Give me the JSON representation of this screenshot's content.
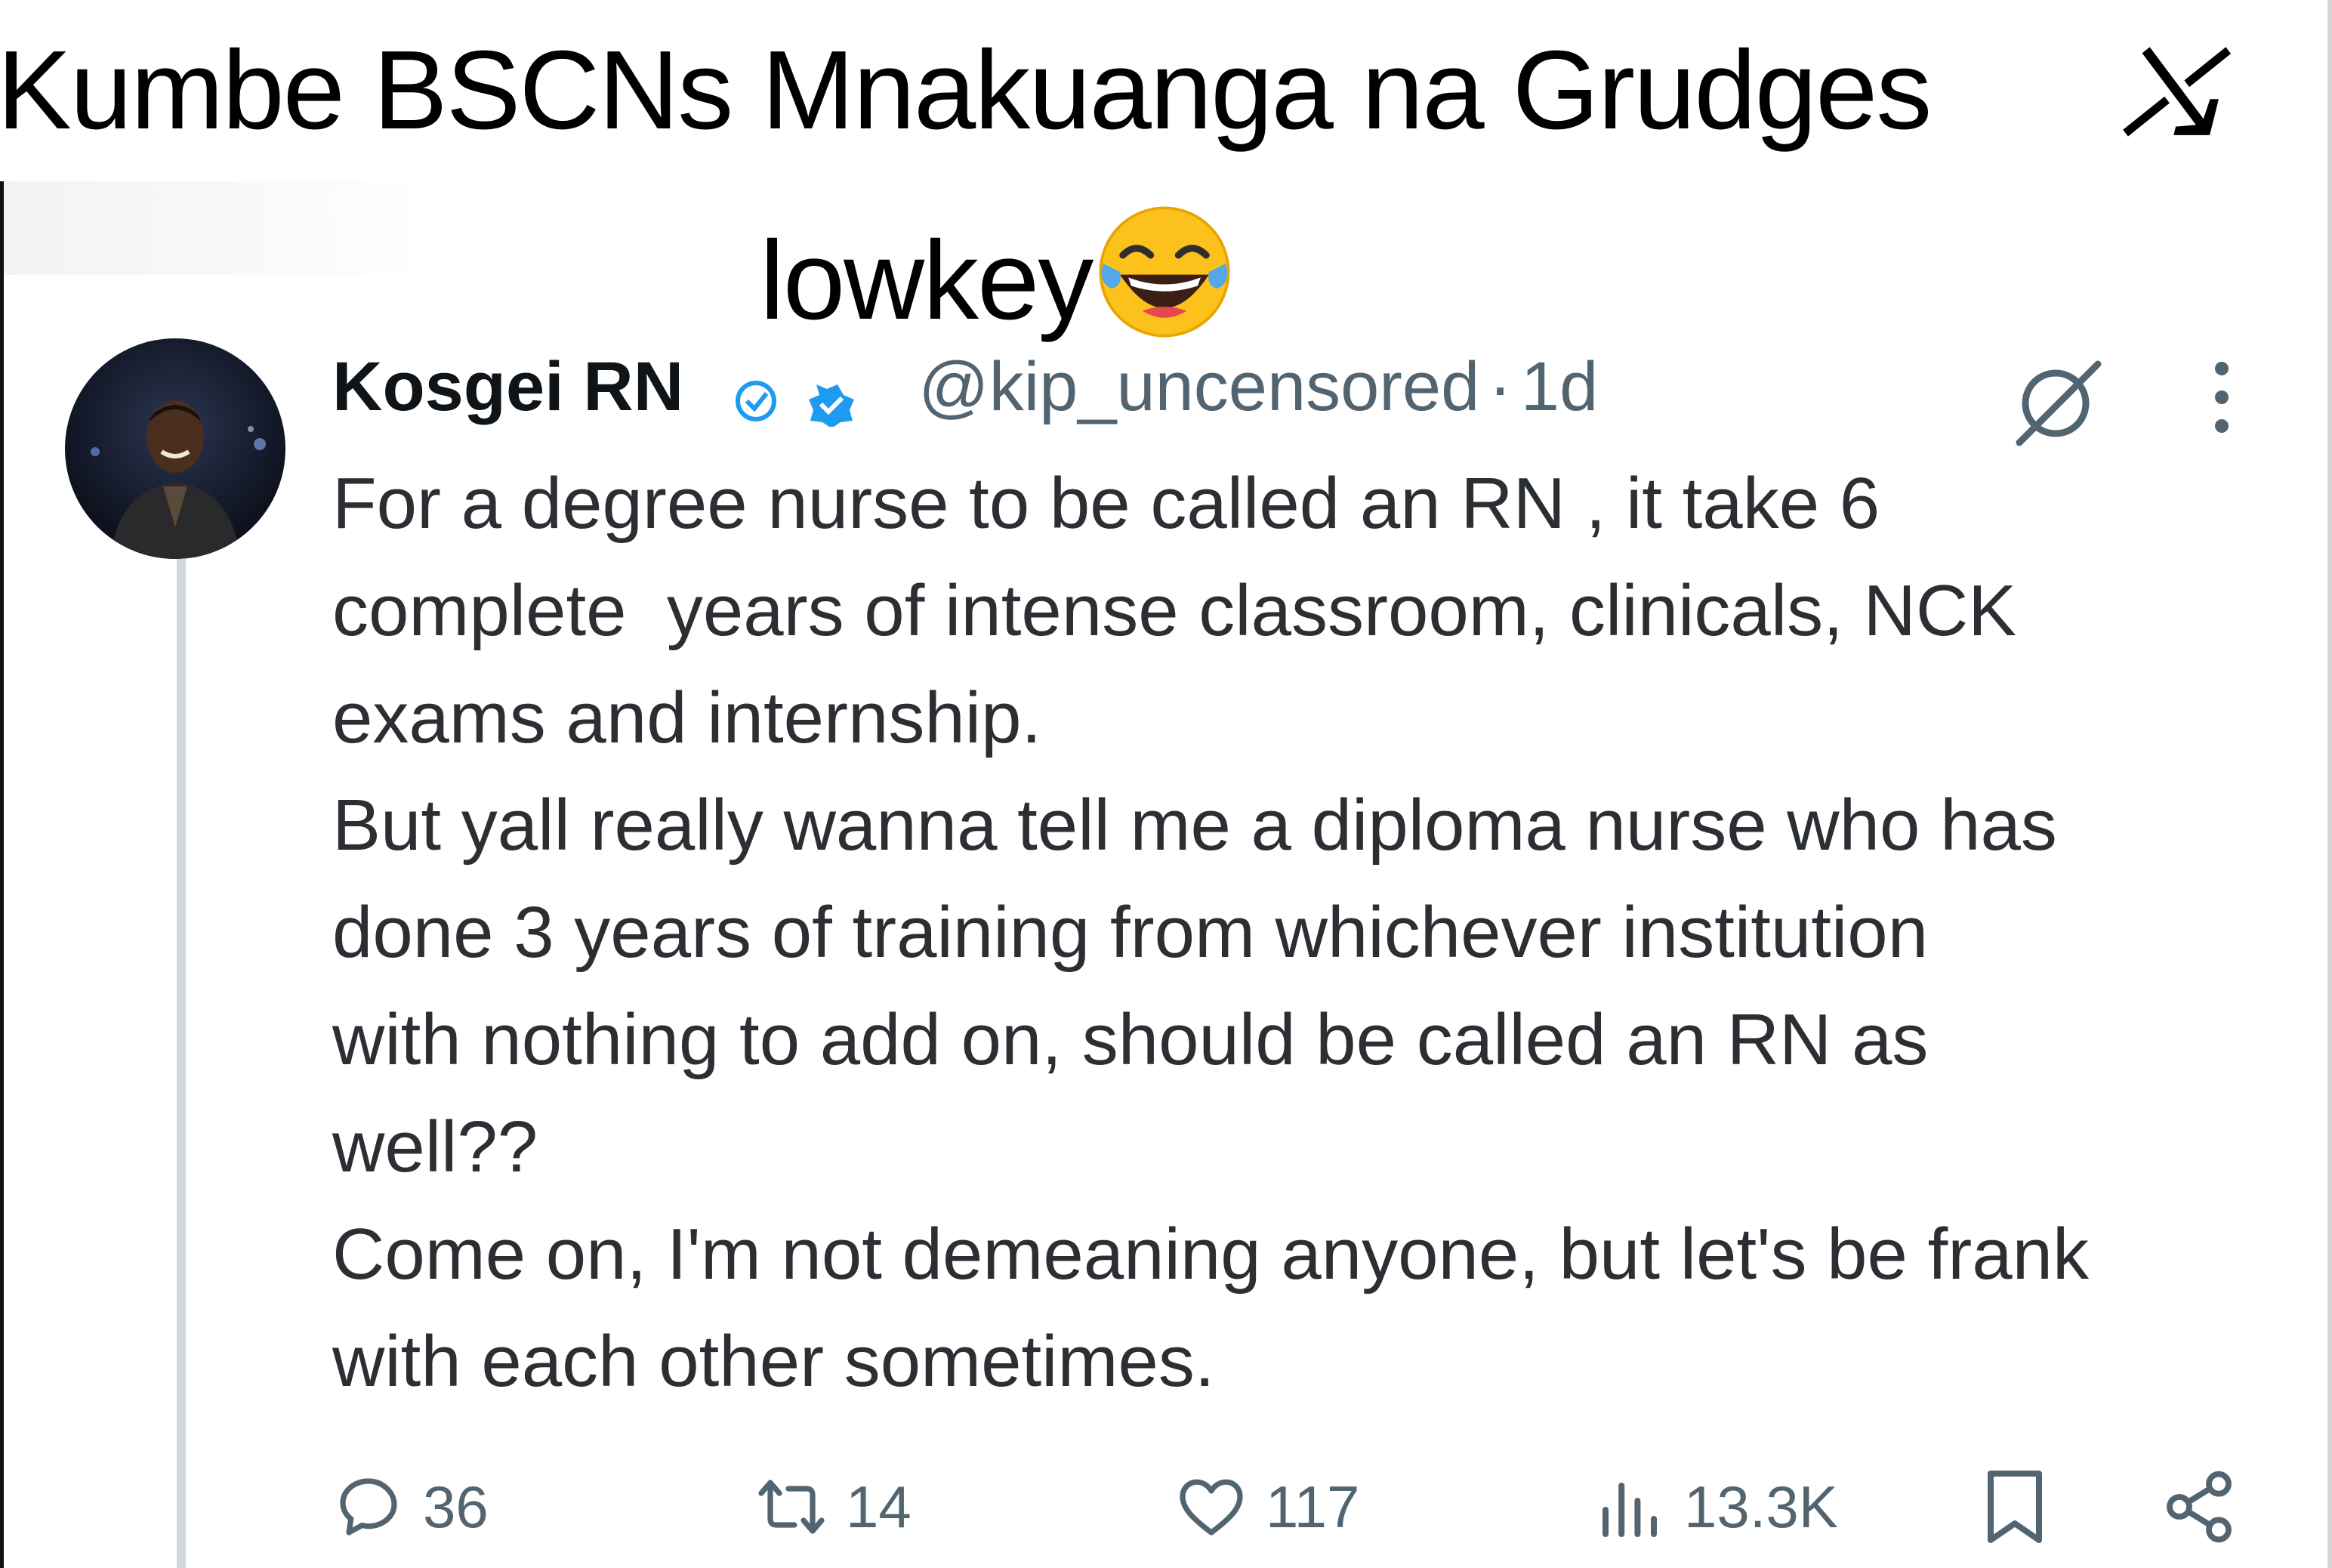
{
  "caption": {
    "line1": "Kumbe BSCNs Mnakuanga na Grudges",
    "line2": "lowkey"
  },
  "tweet": {
    "display_name": "Kosgei RN",
    "handle": "@kip_uncensored",
    "separator": "·",
    "time": "1d",
    "paragraphs": [
      "For a degree nurse to be called an RN , it take 6\ncomplete  years of intense classroom, clinicals, NCK\nexams and internship.",
      "But yall really wanna tell me a diploma nurse who has\ndone 3 years of training from whichever institution\nwith nothing to add on, should be called an RN as\nwell??",
      "Come on, I'm not demeaning anyone, but let's be frank\nwith each other sometimes."
    ]
  },
  "actions": {
    "replies": "36",
    "reposts": "14",
    "likes": "117",
    "views": "13.3K"
  },
  "icons": {
    "caption_emoji": "face-with-tears-of-joy",
    "verified": "verified-badge",
    "grok": "grok-icon",
    "more": "more-vertical-icon"
  },
  "colors": {
    "text_primary": "#0f1419",
    "text_secondary": "#536471",
    "verified_blue": "#1d9bf0",
    "thread_line": "#cfd9de"
  }
}
